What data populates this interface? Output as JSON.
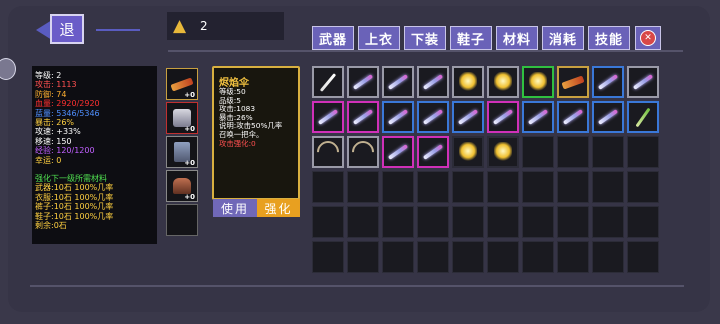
{
  "back_button": {
    "label": "退",
    "icon": "back-arrow-icon"
  },
  "gold": {
    "icon": "gold-coins-icon",
    "value": "2"
  },
  "tabs": [
    {
      "label": "武器"
    },
    {
      "label": "上衣"
    },
    {
      "label": "下装"
    },
    {
      "label": "鞋子"
    },
    {
      "label": "材料"
    },
    {
      "label": "消耗"
    },
    {
      "label": "技能"
    }
  ],
  "close_icon": "close-icon",
  "stats": {
    "lines": [
      {
        "text": "等级: 2",
        "color": "#ffffff"
      },
      {
        "text": "攻击: 1113",
        "color": "#ff5050"
      },
      {
        "text": "防御: 74",
        "color": "#ffb030"
      },
      {
        "text": "血量: 2920/2920",
        "color": "#ff3030"
      },
      {
        "text": "蓝量: 5346/5346",
        "color": "#5090ff"
      },
      {
        "text": "暴击: 26%",
        "color": "#ffd040"
      },
      {
        "text": "攻速: +33%",
        "color": "#ffffff"
      },
      {
        "text": "移速: 150",
        "color": "#ffffff"
      },
      {
        "text": "经验: 120/1200",
        "color": "#c060ff"
      },
      {
        "text": "幸运: 0",
        "color": "#ffd040"
      }
    ],
    "enhance_title": "强化下一级所需材料",
    "enhance_lines": [
      "武器:10石 100%几率",
      "衣服:10石 100%几率",
      "裤子:10石 100%几率",
      "鞋子:10石 100%几率",
      "剩余:0石"
    ]
  },
  "equipment": [
    {
      "icon": "gun-icon",
      "plus": "+0",
      "border": "#c8a040"
    },
    {
      "icon": "armor-icon",
      "plus": "+0",
      "border": "#c03030"
    },
    {
      "icon": "pants-icon",
      "plus": "+0",
      "border": "#888888"
    },
    {
      "icon": "boot-icon",
      "plus": "+0",
      "border": "#888888"
    },
    {
      "icon": "empty-slot-icon",
      "plus": "",
      "border": "#666666"
    }
  ],
  "item_detail": {
    "title": "烬焰伞",
    "lines": [
      {
        "text": "等级:50",
        "color": "#ffffff"
      },
      {
        "text": "品级:5",
        "color": "#ffffff"
      },
      {
        "text": "攻击:1083",
        "color": "#ffffff"
      },
      {
        "text": "暴击:26%",
        "color": "#ffffff"
      },
      {
        "text": "说明:攻击50%几率",
        "color": "#ffffff"
      },
      {
        "text": "召唤一把伞。",
        "color": "#ffffff"
      },
      {
        "text": "攻击强化:0",
        "color": "#ff5050"
      }
    ],
    "use_label": "使用",
    "upgrade_label": "强化"
  },
  "inventory": {
    "columns": 10,
    "rows": 6,
    "items": [
      {
        "icon": "sword-plain-icon",
        "border": "#9a9aa8"
      },
      {
        "icon": "magic-sword-icon",
        "border": "#9a9aa8"
      },
      {
        "icon": "magic-sword-icon",
        "border": "#9a9aa8"
      },
      {
        "icon": "magic-sword-icon",
        "border": "#9a9aa8"
      },
      {
        "icon": "golden-wings-icon",
        "border": "#9a9aa8"
      },
      {
        "icon": "golden-wings-icon",
        "border": "#9a9aa8"
      },
      {
        "icon": "golden-wings-icon",
        "border": "#30c040"
      },
      {
        "icon": "gun-icon",
        "border": "#c8a040"
      },
      {
        "icon": "magic-sword-icon",
        "border": "#3a78d8"
      },
      {
        "icon": "magic-sword-icon",
        "border": "#9a9aa8"
      },
      {
        "icon": "magic-sword-icon",
        "border": "#d030b8"
      },
      {
        "icon": "magic-sword-icon",
        "border": "#d030b8"
      },
      {
        "icon": "magic-sword-icon",
        "border": "#3a78d8"
      },
      {
        "icon": "magic-sword-icon",
        "border": "#3a78d8"
      },
      {
        "icon": "magic-sword-icon",
        "border": "#3a78d8"
      },
      {
        "icon": "magic-sword-icon",
        "border": "#d030b8"
      },
      {
        "icon": "magic-sword-icon",
        "border": "#3a78d8"
      },
      {
        "icon": "magic-sword-icon",
        "border": "#3a78d8"
      },
      {
        "icon": "magic-sword-icon",
        "border": "#3a78d8"
      },
      {
        "icon": "green-sword-icon",
        "border": "#3a78d8"
      },
      {
        "icon": "bow-icon",
        "border": "#9a9aa8"
      },
      {
        "icon": "bow-icon",
        "border": "#9a9aa8"
      },
      {
        "icon": "magic-sword-icon",
        "border": "#d030b8"
      },
      {
        "icon": "magic-sword-icon",
        "border": "#d030b8"
      },
      {
        "icon": "golden-wings-icon",
        "border": "#2c2c38"
      },
      {
        "icon": "golden-wings-icon",
        "border": "#2c2c38"
      }
    ]
  }
}
